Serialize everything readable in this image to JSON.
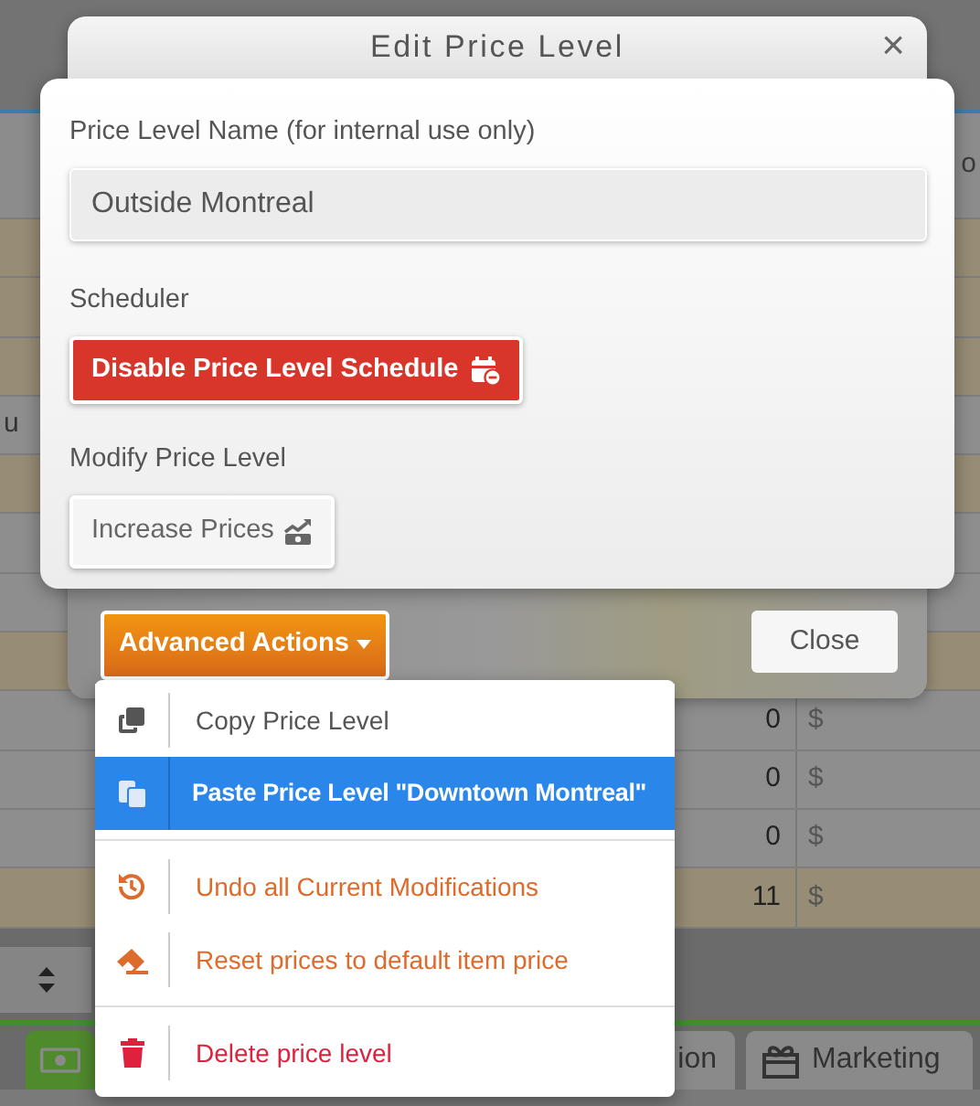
{
  "background": {
    "header_cell": "o",
    "rows": [
      {
        "highlighted": true
      },
      {
        "highlighted": true
      },
      {
        "highlighted": true
      },
      {
        "highlighted": false,
        "cell_1": "u"
      },
      {
        "highlighted": true
      },
      {
        "highlighted": false
      },
      {
        "highlighted": false
      },
      {
        "highlighted": true
      },
      {
        "highlighted": false,
        "quantity": "0",
        "currency": "$"
      },
      {
        "highlighted": false,
        "quantity": "0",
        "currency": "$"
      },
      {
        "highlighted": false,
        "quantity": "0",
        "currency": "$"
      },
      {
        "highlighted": true,
        "quantity": "11",
        "currency": "$"
      }
    ],
    "bottom_tabs": [
      {
        "selected": true
      },
      {
        "label": "ion",
        "selected": false
      },
      {
        "label": "Marketing",
        "selected": false
      }
    ]
  },
  "dialog": {
    "title": "Edit Price Level",
    "close_symbol": "×",
    "name_label": "Price Level Name (for internal use only)",
    "name_value": "Outside Montreal",
    "scheduler_label": "Scheduler",
    "scheduler_button": "Disable Price Level Schedule",
    "modify_label": "Modify Price Level",
    "modify_button": "Increase Prices",
    "advanced_button": "Advanced Actions",
    "close_button": "Close"
  },
  "advanced_menu": {
    "groups": [
      [
        {
          "label": "Copy Price Level",
          "kind": "normal",
          "selected": false
        },
        {
          "label": "Paste Price Level \"Downtown Montreal\"",
          "kind": "normal",
          "selected": true
        }
      ],
      [
        {
          "label": "Undo all Current Modifications",
          "kind": "warning",
          "selected": false
        },
        {
          "label": "Reset prices to default item price",
          "kind": "warning",
          "selected": false
        }
      ],
      [
        {
          "label": "Delete price level",
          "kind": "danger",
          "selected": false
        }
      ]
    ]
  }
}
